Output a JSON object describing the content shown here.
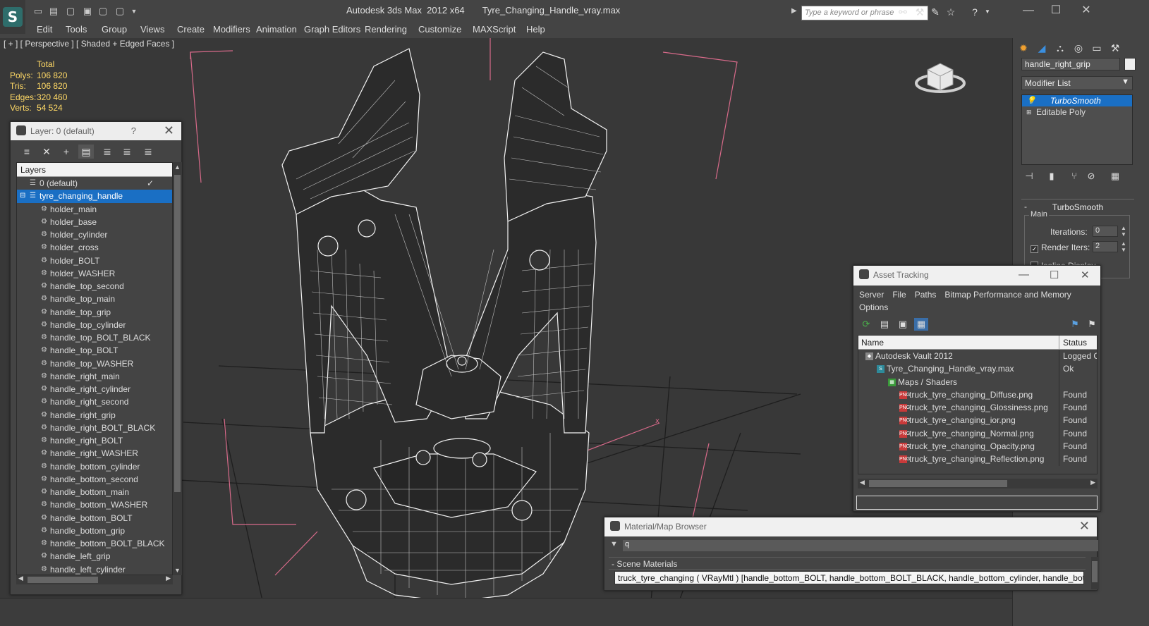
{
  "window": {
    "title": "Autodesk 3ds Max  2012 x64       Tyre_Changing_Handle_vray.max",
    "search_placeholder": "Type a keyword or phrase"
  },
  "menu": [
    "Edit",
    "Tools",
    "Group",
    "Views",
    "Create",
    "Modifiers",
    "Animation",
    "Graph Editors",
    "Rendering",
    "Customize",
    "MAXScript",
    "Help"
  ],
  "viewport": {
    "label": "[ + ] [ Perspective ] [ Shaded + Edged Faces ]",
    "stats": {
      "header": "Total",
      "rows": [
        {
          "k": "Polys:",
          "v": "106 820"
        },
        {
          "k": "Tris:",
          "v": "106 820"
        },
        {
          "k": "Edges:",
          "v": "320 460"
        },
        {
          "k": "Verts:",
          "v": "54 524"
        }
      ]
    }
  },
  "command_panel": {
    "object_name": "handle_right_grip",
    "modifier_list": "Modifier List",
    "stack": [
      "TurboSmooth",
      "Editable Poly"
    ],
    "rollout_title": "TurboSmooth",
    "group_label": "Main",
    "iterations_label": "Iterations:",
    "iterations_value": "0",
    "render_iters_label": "Render Iters:",
    "render_iters_value": "2",
    "isoline_label": "Isoline Display"
  },
  "layer_panel": {
    "title": "Layer: 0 (default)",
    "help": "?",
    "header": "Layers",
    "default_layer": "0 (default)",
    "group_layer": "tyre_changing_handle",
    "objects": [
      "holder_main",
      "holder_base",
      "holder_cylinder",
      "holder_cross",
      "holder_BOLT",
      "holder_WASHER",
      "handle_top_second",
      "handle_top_main",
      "handle_top_grip",
      "handle_top_cylinder",
      "handle_top_BOLT_BLACK",
      "handle_top_BOLT",
      "handle_top_WASHER",
      "handle_right_main",
      "handle_right_cylinder",
      "handle_right_second",
      "handle_right_grip",
      "handle_right_BOLT_BLACK",
      "handle_right_BOLT",
      "handle_right_WASHER",
      "handle_bottom_cylinder",
      "handle_bottom_second",
      "handle_bottom_main",
      "handle_bottom_WASHER",
      "handle_bottom_BOLT",
      "handle_bottom_grip",
      "handle_bottom_BOLT_BLACK",
      "handle_left_grip",
      "handle_left_cylinder"
    ]
  },
  "asset_panel": {
    "title": "Asset Tracking",
    "menu": [
      "Server",
      "File",
      "Paths",
      "Bitmap Performance and Memory",
      "Options"
    ],
    "columns": [
      "Name",
      "Status"
    ],
    "rows": [
      {
        "name": "Autodesk Vault 2012",
        "status": "Logged O",
        "indent": 24,
        "icon": "vault"
      },
      {
        "name": "Tyre_Changing_Handle_vray.max",
        "status": "Ok",
        "indent": 40,
        "icon": "max"
      },
      {
        "name": "Maps / Shaders",
        "status": "",
        "indent": 56,
        "icon": "maps"
      },
      {
        "name": "truck_tyre_changing_Diffuse.png",
        "status": "Found",
        "indent": 72,
        "icon": "png"
      },
      {
        "name": "truck_tyre_changing_Glossiness.png",
        "status": "Found",
        "indent": 72,
        "icon": "png"
      },
      {
        "name": "truck_tyre_changing_ior.png",
        "status": "Found",
        "indent": 72,
        "icon": "png"
      },
      {
        "name": "truck_tyre_changing_Normal.png",
        "status": "Found",
        "indent": 72,
        "icon": "png"
      },
      {
        "name": "truck_tyre_changing_Opacity.png",
        "status": "Found",
        "indent": 72,
        "icon": "png"
      },
      {
        "name": "truck_tyre_changing_Reflection.png",
        "status": "Found",
        "indent": 72,
        "icon": "png"
      }
    ]
  },
  "material_panel": {
    "title": "Material/Map Browser",
    "search_value": "q",
    "section": "- Scene Materials",
    "entry": "truck_tyre_changing ( VRayMtl ) [handle_bottom_BOLT, handle_bottom_BOLT_BLACK, handle_bottom_cylinder, handle_bottom_grip..."
  },
  "colors": {
    "selection": "#1a6fc4",
    "stats_text": "#ffd966",
    "viewport_bg": "#383838",
    "wire": "#ffffff"
  }
}
